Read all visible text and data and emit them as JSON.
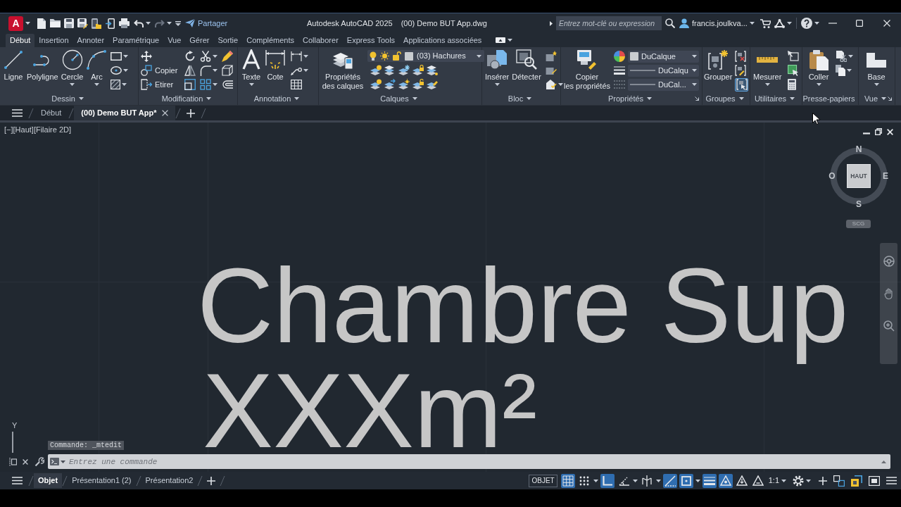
{
  "title_bar": {
    "app_letter": "A",
    "share": "Partager",
    "app_name": "Autodesk AutoCAD 2025",
    "file_name": "(00) Demo BUT App.dwg",
    "search": {
      "placeholder": "Entrez mot-clé ou expression"
    },
    "user": "francis.joulkva..."
  },
  "ribbon_tabs": [
    {
      "label": "Début",
      "selected": true
    },
    {
      "label": "Insertion",
      "selected": false
    },
    {
      "label": "Annoter",
      "selected": false
    },
    {
      "label": "Paramétrique",
      "selected": false
    },
    {
      "label": "Vue",
      "selected": false
    },
    {
      "label": "Gérer",
      "selected": false
    },
    {
      "label": "Sortie",
      "selected": false
    },
    {
      "label": "Compléments",
      "selected": false
    },
    {
      "label": "Collaborer",
      "selected": false
    },
    {
      "label": "Express Tools",
      "selected": false
    },
    {
      "label": "Applications associées",
      "selected": false
    }
  ],
  "ribbon_panels": [
    {
      "kind": "draw",
      "title": "Dessin",
      "menu": true,
      "launcher": false,
      "buttons": [
        {
          "label": "Ligne",
          "menu": false
        },
        {
          "label": "Polyligne",
          "menu": false
        },
        {
          "label": "Cercle",
          "menu": true
        },
        {
          "label": "Arc",
          "menu": true
        }
      ]
    },
    {
      "kind": "modify",
      "title": "Modification",
      "menu": true,
      "launcher": false,
      "labels": [
        "Copier",
        "Etirer"
      ]
    },
    {
      "kind": "annotation",
      "title": "Annotation",
      "menu": true,
      "launcher": false,
      "buttons": [
        {
          "label": "Texte",
          "menu": true
        },
        {
          "label": "Cote",
          "menu": false
        }
      ]
    },
    {
      "kind": "layers",
      "title": "Calques",
      "menu": true,
      "launcher": false,
      "buttons": [
        {
          "label": "Propriétés des calques",
          "menu": false
        }
      ],
      "layer": "(03) Hachures"
    },
    {
      "kind": "block",
      "title": "Bloc",
      "menu": true,
      "launcher": false,
      "buttons": [
        {
          "label": "Insérer",
          "menu": true
        },
        {
          "label": "Détecter",
          "menu": false
        }
      ]
    },
    {
      "kind": "properties",
      "title": "Propriétés",
      "menu": true,
      "launcher": true,
      "buttons": [
        {
          "label": "Copier\nles propriétés",
          "menu": false
        }
      ],
      "combos": [
        {
          "kind": "color",
          "value": "DuCalque"
        },
        {
          "kind": "linetype",
          "value": "DuCalqu"
        },
        {
          "kind": "lineweight",
          "value": "DuCal..."
        }
      ]
    },
    {
      "kind": "groups",
      "title": "Groupes",
      "menu": true,
      "launcher": false,
      "buttons": [
        {
          "label": "Grouper",
          "menu": false
        }
      ],
      "selection_toggle": {
        "on": true
      }
    },
    {
      "kind": "utilities",
      "title": "Utilitaires",
      "menu": true,
      "launcher": false,
      "buttons": [
        {
          "label": "Mesurer",
          "menu": true
        }
      ]
    },
    {
      "kind": "clipboard",
      "title": "Presse-papiers",
      "menu": false,
      "launcher": false,
      "buttons": [
        {
          "label": "Coller",
          "menu": true
        }
      ]
    },
    {
      "kind": "view",
      "title": "Vue",
      "menu": true,
      "launcher": true,
      "buttons": [
        {
          "label": "Base",
          "menu": true
        }
      ]
    }
  ],
  "file_tabs": [
    {
      "label": "Début",
      "selected": false
    },
    {
      "label": "(00) Demo BUT App*",
      "selected": true
    }
  ],
  "viewport": {
    "controls_label": "[−][Haut][Filaire 2D]",
    "view_cube": {
      "north": "N",
      "west": "O",
      "top_face": "HAUT",
      "east": "E",
      "south": "S",
      "ucs_button": "SCG"
    },
    "drawing_text": [
      "Chambre Sup",
      "XXXm²"
    ],
    "ucs_y_label": "Y"
  },
  "command_line": {
    "history": "Commande: _mtedit",
    "placeholder": "Entrez une commande"
  },
  "layout_tabs": [
    {
      "label": "Objet",
      "selected": true
    },
    {
      "label": "Présentation1 (2)",
      "selected": false
    },
    {
      "label": "Présentation2",
      "selected": false
    }
  ],
  "status_bar": {
    "space": "OBJET",
    "tools": [
      {
        "kind": "grid",
        "on": true
      },
      {
        "kind": "snap",
        "on": false
      },
      {
        "kind": "ortho",
        "on": true
      },
      {
        "kind": "polar",
        "on": false
      },
      {
        "kind": "isodraft",
        "on": false
      },
      {
        "kind": "tracking",
        "on": true
      },
      {
        "kind": "osnap",
        "on": true
      },
      {
        "kind": "lineweight",
        "on": true
      },
      {
        "kind": "annotation_visibility",
        "on": true
      },
      {
        "kind": "autoscale",
        "on": false
      },
      {
        "kind": "annotation_scale",
        "on": false
      }
    ],
    "annotation_scale": "1:1"
  }
}
